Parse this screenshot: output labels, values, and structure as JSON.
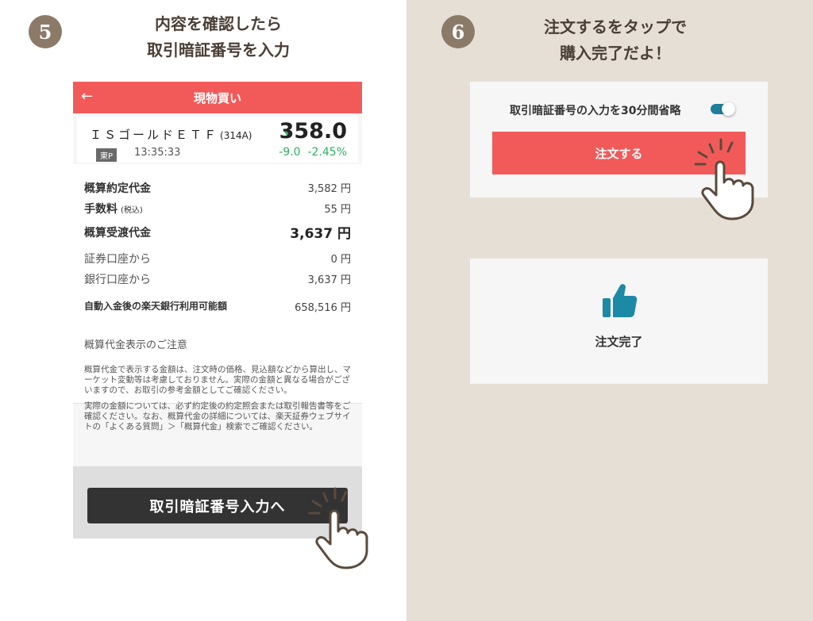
{
  "step5": {
    "number": "5",
    "title_line1": "内容を確認したら",
    "title_line2": "取引暗証番号を入力"
  },
  "step6": {
    "number": "6",
    "title_line1": "注文するをタップで",
    "title_line2": "購入完了だよ！"
  },
  "screen": {
    "back_icon": "←",
    "header_title": "現物買い",
    "stock": {
      "name": "ＩＳゴールドＥＴＦ",
      "code": "(314A)",
      "market_badge": "東P",
      "time": "13:35:33",
      "price": "358.0",
      "change": "-9.0",
      "change_pct": "-2.45%"
    },
    "rows": [
      {
        "label": "概算約定代金",
        "label_note": "",
        "value": "3,582 円"
      },
      {
        "label": "手数料",
        "label_note": "(税込)",
        "value": "55 円"
      },
      {
        "label": "概算受渡代金",
        "label_note": "",
        "value": "3,637 円"
      },
      {
        "label": "証券口座から",
        "label_note": "",
        "value": "0 円"
      },
      {
        "label": "銀行口座から",
        "label_note": "",
        "value": "3,637 円"
      },
      {
        "label": "自動入金後の楽天銀行利用可能額",
        "label_note": "",
        "value": "658,516 円"
      }
    ],
    "notice_title": "概算代金表示のご注意",
    "notice_p1": "概算代金で表示する金額は、注文時の価格、見込額などから算出し、マーケット変動等は考慮しておりません。実際の金額と異なる場合がございますので、お取引の参考金額としてご確認ください。",
    "notice_p2": "実際の金額については、必ず約定後の約定照会または取引報告書等をご確認ください。なお、概算代金の詳細については、楽天証券ウェブサイトの「よくある質問」＞「概算代金」検索でご確認ください。",
    "submit_button": "取引暗証番号入力へ"
  },
  "order_panel": {
    "skip_label": "取引暗証番号の入力を30分間省略",
    "toggle_on": true,
    "order_button": "注文する"
  },
  "complete_panel": {
    "icon": "thumbs-up-icon",
    "label": "注文完了"
  },
  "colors": {
    "accent_red": "#f25a5a",
    "step_circle": "#8c7a68",
    "right_bg": "#e6dfd5",
    "down_green": "#2eaf62",
    "toggle_teal": "#1d7f9b",
    "thumb_teal": "#1c8aa6"
  }
}
